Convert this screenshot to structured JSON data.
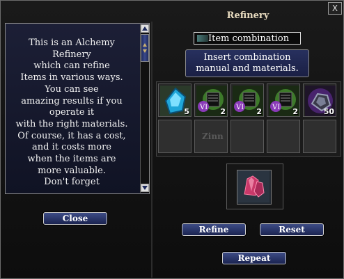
{
  "window": {
    "title": "Refinery",
    "close_glyph": "X"
  },
  "description": {
    "lines": [
      "This is an Alchemy",
      "Refinery",
      "which can refine",
      "Items in various ways.",
      "You can see",
      "amazing results if you",
      "operate it",
      "with the right materials.",
      "Of course, it has a cost,",
      "and it costs more",
      "when the items are",
      "more valuable.",
      "Don't forget"
    ]
  },
  "buttons": {
    "close": "Close",
    "refine": "Refine",
    "reset": "Reset",
    "repeat": "Repeat"
  },
  "mode": {
    "label": "Item combination"
  },
  "instruction": {
    "line1": "Insert combination",
    "line2": "manual and materials."
  },
  "slots_top": [
    {
      "item": "blue-gem-icon",
      "count": "5"
    },
    {
      "item": "combination-manual-icon",
      "count": "2"
    },
    {
      "item": "combination-manual-icon",
      "count": "2"
    },
    {
      "item": "combination-manual-icon",
      "count": "2"
    },
    {
      "item": "purple-ore-icon",
      "count": "50"
    }
  ],
  "slots_bottom_placeholder": "Zinn",
  "result": {
    "item": "red-crystal-icon"
  },
  "colors": {
    "panel": "#1c1f36",
    "button": "#2a366a",
    "title": "#e9dcc0"
  }
}
